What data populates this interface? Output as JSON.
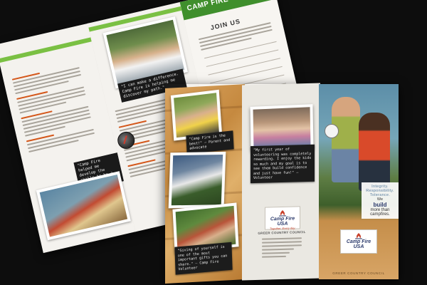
{
  "back_brochure": {
    "brand": "CAMP FIRE",
    "join_heading": "JOIN US",
    "quote_top": "\"I can make a difference. Camp Fire is helping me discover my path.\"",
    "quote_bottom": "\"Camp Fire helped me develop the skills to be a leader.\""
  },
  "front_brochure": {
    "caption_left_top": "\"Camp Fire is the best!\" — Parent and advocate",
    "caption_left_bottom": "\"Giving of yourself is one of the most important gifts you can share.\" — Camp Fire Volunteer",
    "caption_middle": "\"My first year of volunteering was completely rewarding. I enjoy the kids so much and my goal is to see them build confidence and just have fun!\" — Volunteer",
    "logo_name": "Camp Fire USA",
    "logo_sub": "Together. Every day.",
    "council_name": "GREER COUNTRY COUNCIL",
    "tagline_values": "Integrity. Responsibility. Tolerance.",
    "tagline_we": "We",
    "tagline_build": "build",
    "tagline_more": "more than campfires.",
    "footer_council": "GREER COUNTRY COUNCIL"
  },
  "colors": {
    "brand_green": "#3f8f2c",
    "accent_orange": "#d4571a",
    "brand_navy": "#2b3a6b",
    "background": "#0d0d0d"
  }
}
